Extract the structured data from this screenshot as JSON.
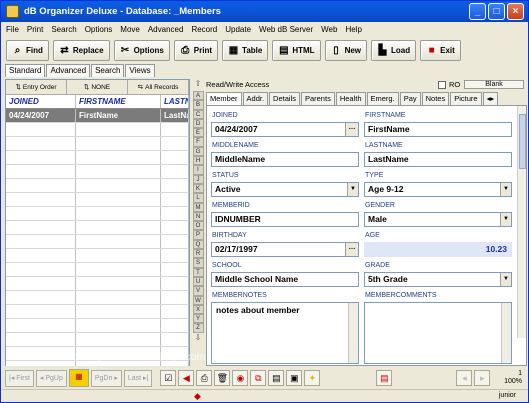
{
  "window": {
    "title": "dB Organizer Deluxe - Database: _Members"
  },
  "menu": [
    "File",
    "Print",
    "Search",
    "Options",
    "Move",
    "Advanced",
    "Record",
    "Update",
    "Web dB Server",
    "Web",
    "Help"
  ],
  "toolbar": {
    "find": "Find",
    "replace": "Replace",
    "options": "Options",
    "print": "Print",
    "table": "Table",
    "html": "HTML",
    "new": "New",
    "load": "Load",
    "exit": "Exit"
  },
  "mode_tabs": [
    "Standard",
    "Advanced",
    "Search",
    "Views"
  ],
  "sort_buttons": [
    "Entry Order",
    "NONE",
    "All Records"
  ],
  "grid": {
    "columns": [
      "JOINED",
      "FIRSTNAME",
      "LASTNAME"
    ],
    "rows": [
      [
        "04/24/2007",
        "FirstName",
        "LastName"
      ]
    ]
  },
  "letters": [
    "A",
    "B",
    "C",
    "D",
    "E",
    "F",
    "G",
    "H",
    "I",
    "J",
    "K",
    "L",
    "M",
    "N",
    "O",
    "P",
    "Q",
    "R",
    "S",
    "T",
    "U",
    "V",
    "W",
    "X",
    "Y",
    "Z"
  ],
  "access": {
    "label": "Read/Write Access",
    "ro_label": "RO",
    "blank_label": "Blank"
  },
  "form_tabs": [
    "Member",
    "Addr.",
    "Details",
    "Parents",
    "Health",
    "Emerg.",
    "Pay",
    "Notes",
    "Picture"
  ],
  "fields": {
    "joined": {
      "label": "JOINED",
      "value": "04/24/2007"
    },
    "firstname": {
      "label": "FIRSTNAME",
      "value": "FirstName"
    },
    "middlename": {
      "label": "MIDDLENAME",
      "value": "MiddleName"
    },
    "lastname": {
      "label": "LASTNAME",
      "value": "LastName"
    },
    "status": {
      "label": "STATUS",
      "value": "Active"
    },
    "type": {
      "label": "TYPE",
      "value": "Age 9-12"
    },
    "memberid": {
      "label": "MEMBERID",
      "value": "IDNUMBER"
    },
    "gender": {
      "label": "GENDER",
      "value": "Male"
    },
    "birthday": {
      "label": "BIRTHDAY",
      "value": "02/17/1997"
    },
    "age": {
      "label": "AGE",
      "value": "10.23"
    },
    "school": {
      "label": "SCHOOL",
      "value": "Middle School Name"
    },
    "grade": {
      "label": "GRADE",
      "value": "5th Grade"
    },
    "membernotes": {
      "label": "MEMBERNOTES",
      "value": "notes about member"
    },
    "membercomments": {
      "label": "MEMBERCOMMENTS",
      "value": ""
    }
  },
  "nav": {
    "first": "First",
    "pgup": "PgUp",
    "pgdn": "PgDn",
    "last": "Last"
  },
  "status": {
    "record": "1",
    "zoom": "100%",
    "user": "junior"
  },
  "watermark": "www.heritagechristiancollege.com"
}
